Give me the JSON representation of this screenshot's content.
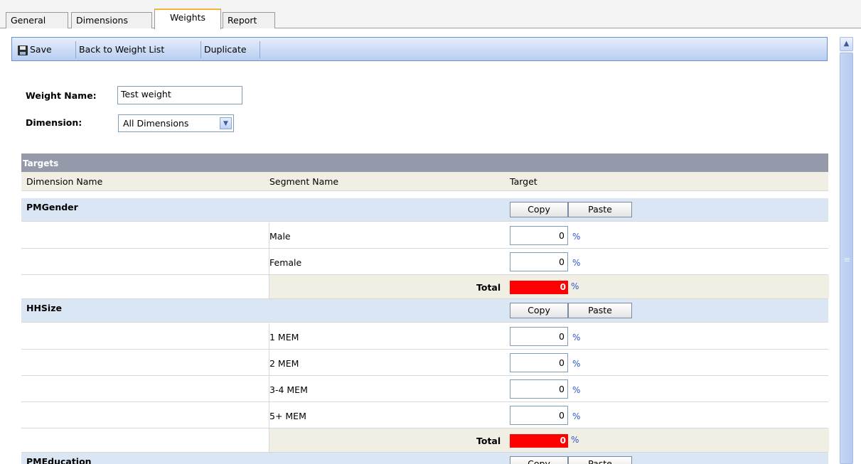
{
  "tabs": [
    {
      "label": "General",
      "active": false
    },
    {
      "label": "Dimensions",
      "active": false
    },
    {
      "label": "Weights",
      "active": true
    },
    {
      "label": "Report",
      "active": false
    }
  ],
  "toolbar": {
    "save_label": "Save",
    "back_label": "Back to Weight List",
    "duplicate_label": "Duplicate"
  },
  "form": {
    "weight_name_label": "Weight Name:",
    "weight_name_value": "Test weight",
    "dimension_label": "Dimension:",
    "dimension_value": "All Dimensions"
  },
  "targets": {
    "title": "Targets",
    "columns": [
      "Dimension Name",
      "Segment Name",
      "Target"
    ],
    "copy_label": "Copy",
    "paste_label": "Paste",
    "total_label": "Total",
    "pct_symbol": "%",
    "dimensions": [
      {
        "name": "PMGender",
        "segments": [
          {
            "name": "Male",
            "target": "0"
          },
          {
            "name": "Female",
            "target": "0"
          }
        ],
        "total": "0"
      },
      {
        "name": "HHSize",
        "segments": [
          {
            "name": "1 MEM",
            "target": "0"
          },
          {
            "name": "2 MEM",
            "target": "0"
          },
          {
            "name": "3-4 MEM",
            "target": "0"
          },
          {
            "name": "5+ MEM",
            "target": "0"
          }
        ],
        "total": "0"
      },
      {
        "name": "PMEducation",
        "segments": [],
        "total": ""
      }
    ]
  },
  "colors": {
    "toolbar_border": "#6d90cc",
    "panel_header": "#959aab",
    "dimension_row": "#dae6f3",
    "column_header": "#f1eee4",
    "total_alert": "#ff0000",
    "percent_text": "#2b56c8",
    "active_tab_accent": "#f0b53c"
  },
  "icons": {
    "save": "floppy-disk-icon",
    "dropdown": "chevron-down-icon",
    "scroll_up": "arrow-up-icon"
  }
}
